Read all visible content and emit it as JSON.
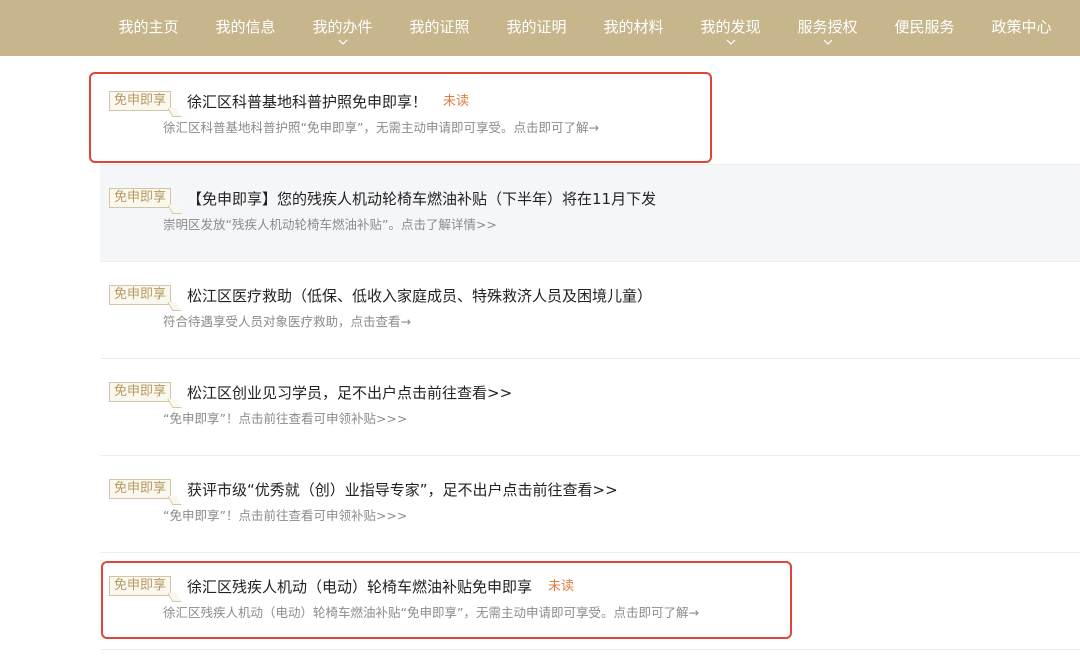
{
  "nav": {
    "items": [
      {
        "label": "我的主页",
        "dropdown": false
      },
      {
        "label": "我的信息",
        "dropdown": false
      },
      {
        "label": "我的办件",
        "dropdown": true
      },
      {
        "label": "我的证照",
        "dropdown": false
      },
      {
        "label": "我的证明",
        "dropdown": false
      },
      {
        "label": "我的材料",
        "dropdown": false
      },
      {
        "label": "我的发现",
        "dropdown": true
      },
      {
        "label": "服务授权",
        "dropdown": true
      },
      {
        "label": "便民服务",
        "dropdown": false
      },
      {
        "label": "政策中心",
        "dropdown": false
      }
    ]
  },
  "messages": [
    {
      "badge": "免申即享",
      "title": "徐汇区科普基地科普护照免申即享！",
      "unread": "未读",
      "desc": "徐汇区科普基地科普护照“免申即享”，无需主动申请即可享受。点击即可了解→",
      "highlighted": true
    },
    {
      "badge": "免申即享",
      "title": "【免申即享】您的残疾人机动轮椅车燃油补贴（下半年）将在11月下发",
      "desc": "崇明区发放“残疾人机动轮椅车燃油补贴”。点击了解详情>>",
      "highlighted": false
    },
    {
      "badge": "免申即享",
      "title": "松江区医疗救助（低保、低收入家庭成员、特殊救济人员及困境儿童）",
      "desc": "符合待遇享受人员对象医疗救助，点击查看→",
      "highlighted": false
    },
    {
      "badge": "免申即享",
      "title": "松江区创业见习学员，足不出户点击前往查看>>",
      "desc": "“免申即享”！点击前往查看可申领补贴>>>",
      "highlighted": false
    },
    {
      "badge": "免申即享",
      "title": "获评市级“优秀就（创）业指导专家”，足不出户点击前往查看>>",
      "desc": "“免申即享”！点击前往查看可申领补贴>>>",
      "highlighted": false
    },
    {
      "badge": "免申即享",
      "title": "徐汇区残疾人机动（电动）轮椅车燃油补贴免申即享",
      "unread": "未读",
      "desc": "徐汇区残疾人机动（电动）轮椅车燃油补贴“免申即享”，无需主动申请即可享受。点击即可了解→",
      "highlighted": true
    }
  ],
  "colors": {
    "nav_bg": "#c7b58c",
    "highlight": "#e0443a",
    "unread": "#e07c43",
    "badge": "#b59a62"
  }
}
